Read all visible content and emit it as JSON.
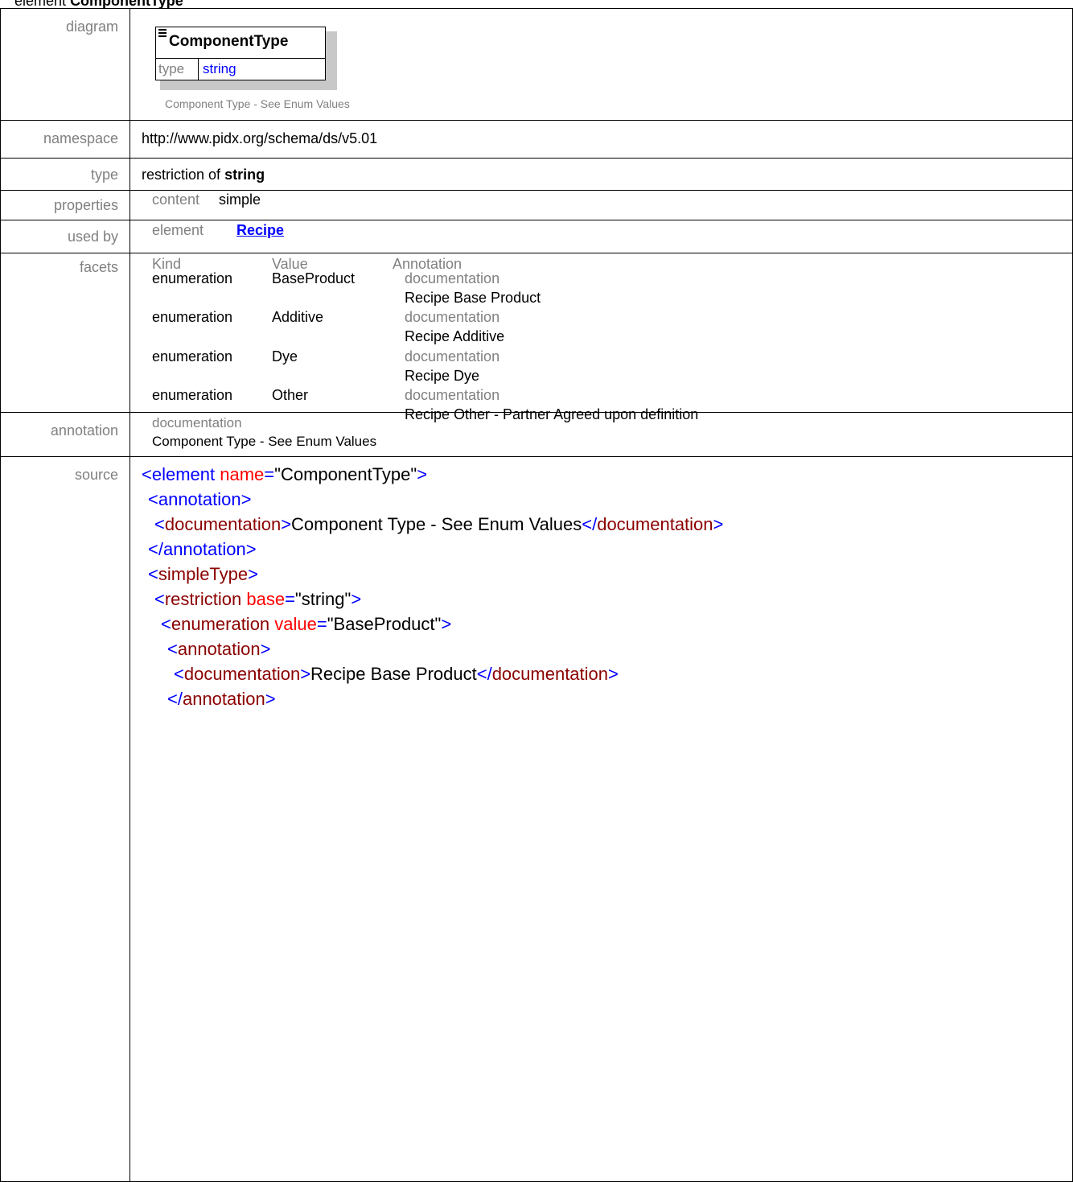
{
  "title": {
    "prefix": "element",
    "name": "ComponentType"
  },
  "labels": {
    "diagram": "diagram",
    "namespace": "namespace",
    "type": "type",
    "properties": "properties",
    "used_by": "used by",
    "facets": "facets",
    "annotation": "annotation",
    "source": "source"
  },
  "diagram": {
    "element_name": "ComponentType",
    "type_label": "type",
    "type_value": "string",
    "documentation": "Component Type - See Enum Values",
    "icon": "element-content-icon"
  },
  "namespace": "http://www.pidx.org/schema/ds/v5.01",
  "type": {
    "prefix": "restriction of",
    "base": "string"
  },
  "properties": {
    "key": "content",
    "value": "simple"
  },
  "used_by": {
    "kind": "element",
    "link": "Recipe"
  },
  "facets": {
    "headers": [
      "Kind",
      "Value",
      "Annotation"
    ],
    "rows": [
      {
        "kind": "enumeration",
        "value": "BaseProduct",
        "annotation_label": "documentation",
        "annotation_text": "Recipe Base Product"
      },
      {
        "kind": "enumeration",
        "value": "Additive",
        "annotation_label": "documentation",
        "annotation_text": "Recipe Additive"
      },
      {
        "kind": "enumeration",
        "value": "Dye",
        "annotation_label": "documentation",
        "annotation_text": "Recipe Dye"
      },
      {
        "kind": "enumeration",
        "value": "Other",
        "annotation_label": "documentation",
        "annotation_text": "Recipe Other - Partner Agreed upon definition"
      }
    ]
  },
  "annotation": {
    "label": "documentation",
    "text": "Component Type - See Enum Values"
  },
  "source": {
    "element_open": "<element",
    "attr_name": "name",
    "attr_name_value": "\"ComponentType\"",
    "tag_close": ">",
    "annotation_open": "<annotation>",
    "documentation_open": "<documentation>",
    "documentation_text": "Component Type - See Enum Values",
    "documentation_close_bracket": "</",
    "documentation_close_name": "documentation",
    "annotation_close": "</annotation>",
    "simpletype_open": "<simpleType>",
    "restriction_open": "<restriction",
    "attr_base": "base",
    "attr_base_value": "\"string\"",
    "enumeration_open": "<enumeration",
    "attr_value": "value",
    "attr_value_value": "\"BaseProduct\"",
    "enum_annotation_open": "<annotation>",
    "enum_documentation_open": "<documentation>",
    "enum_documentation_text": "Recipe Base Product",
    "enum_documentation_close_bracket": "</",
    "enum_documentation_close_name": "documentation",
    "enum_annotation_close": "</annotation>",
    "equals": "=",
    "gt": ">"
  }
}
